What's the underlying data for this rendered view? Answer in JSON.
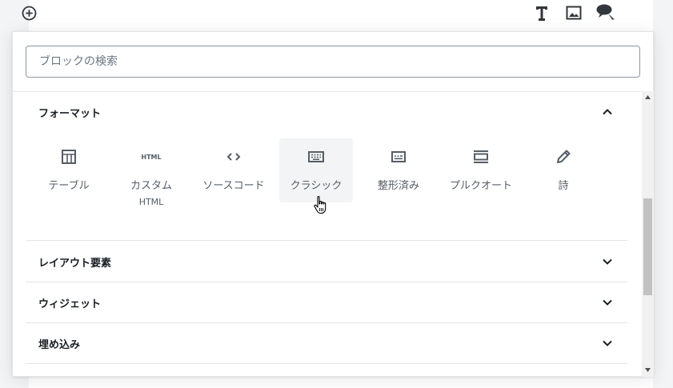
{
  "toolbar": {
    "inserter_icon": "plus-circle-icon",
    "heading_icon": "heading-text-icon",
    "image_icon": "image-icon",
    "comment_icon": "comment-bubble-icon"
  },
  "search": {
    "placeholder": "ブロックの検索",
    "value": ""
  },
  "panels": [
    {
      "title": "フォーマット",
      "expanded": true,
      "blocks": [
        {
          "label": "テーブル",
          "icon": "table-icon"
        },
        {
          "label": "カスタム",
          "sublabel": "HTML",
          "icon": "html-icon",
          "icon_text": "HTML"
        },
        {
          "label": "ソースコード",
          "icon": "code-icon"
        },
        {
          "label": "クラシック",
          "icon": "keyboard-icon",
          "hovered": true
        },
        {
          "label": "整形済み",
          "icon": "preformatted-icon"
        },
        {
          "label": "プルクオート",
          "icon": "pullquote-icon"
        },
        {
          "label": "詩",
          "icon": "pencil-icon"
        }
      ]
    },
    {
      "title": "レイアウト要素",
      "expanded": false
    },
    {
      "title": "ウィジェット",
      "expanded": false
    },
    {
      "title": "埋め込み",
      "expanded": false
    }
  ],
  "colors": {
    "accent_text": "#191e23",
    "muted_text": "#555d66",
    "hover_bg": "#f3f4f5",
    "border": "#e2e4e7"
  }
}
